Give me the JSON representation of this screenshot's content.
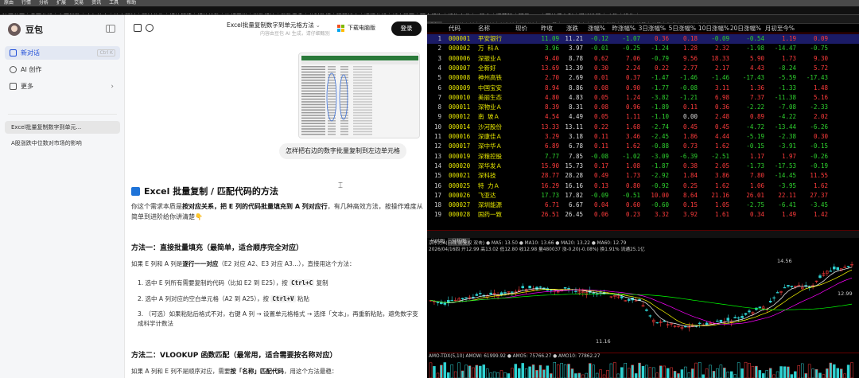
{
  "topbar": {
    "items": [
      "原由",
      "行情",
      "分析",
      "扩展",
      "交易",
      "资讯",
      "工具",
      "帮助"
    ]
  },
  "navbar": {
    "items": [
      "沪深首页",
      "盘面分析",
      "主要指数",
      "人气热点",
      "热点题材",
      "题材龙头",
      "板块解读",
      "板块轮动",
      "连板天梯",
      "指数板块",
      "涨跌看盘",
      "分时数据",
      "强弱排序",
      "运程分析",
      "新大股票",
      "研究报告",
      "机构内参",
      "A股会",
      "问董秘",
      "明星F10",
      "可转债套利",
      "漫谈选股",
      "功能",
      "操作"
    ]
  },
  "sidebar": {
    "app_name": "豆包",
    "nav": [
      {
        "label": "新对话",
        "kbd": "Ctrl K"
      },
      {
        "label": "AI 创作"
      },
      {
        "label": "更多"
      }
    ],
    "history": [
      "Excel批量复制数字到单元...",
      "A股涨跌中位数对市场的影响"
    ]
  },
  "chat": {
    "title": "Excel批量复制数字到单元格方法",
    "subtitle": "内容由豆包 AI 生成，请仔细甄别",
    "download_label": "下载电脑版",
    "login_label": "登录",
    "question": "怎样把右边的数字批量复制到左边单元格",
    "heading": "Excel 批量复制 / 匹配代码的方法",
    "intro_a": "你这个需求本质是",
    "intro_b": "按对应关系，把 E 列的代码批量填充到 A 列对应行",
    "intro_c": "，有几种高效方法，按操作难度从简单到进阶给你讲清楚👇",
    "m1_title": "方法一：直接批量填充（最简单，适合顺序完全对应）",
    "m1_desc_a": "如果 E 列和 A 列是",
    "m1_desc_b": "逐行一一对应",
    "m1_desc_c": "（E2 对应 A2、E3 对应 A3…），直接用这个方法：",
    "m1_steps": [
      {
        "pre": "1. 选中 E 列所有需要复制的代码（比如 E2 到 E25），按 ",
        "key": "Ctrl+C",
        "post": " 复制"
      },
      {
        "pre": "2. 选中 A 列对应的空白单元格（A2 到 A25），按 ",
        "key": "Ctrl+V",
        "post": " 粘贴"
      },
      {
        "pre": "3. （可选）如果粘贴后格式不对，右键 A 列 → 设置单元格格式 → 选择「文本」，再重新粘贴，避免数字变成科学计数法",
        "key": "",
        "post": ""
      }
    ],
    "m2_title": "方法二：VLOOKUP 函数匹配（最常用，适合需要按名称对应）",
    "m2_desc_a": "如果 A 列和 E 列不是顺序对应，需要",
    "m2_desc_b": "按「名称」匹配代码",
    "m2_desc_c": "，用这个方法最稳："
  },
  "stock": {
    "tabs": [
      "全部",
      "两融",
      "沪主板",
      "深主板",
      "创业板",
      "科创板",
      "北证A股",
      "B股",
      "基金",
      "债券",
      "指数",
      "板块",
      "港股",
      "美股",
      "期货",
      "自选",
      "其他",
      "模拟"
    ],
    "selected_tab": "全部",
    "headers": [
      "代码",
      "名称",
      "现价",
      "昨收",
      "涨跌",
      "涨幅%",
      "昨涨幅%",
      "3日涨幅%",
      "5日涨幅%",
      "10日涨幅%",
      "20日涨幅%",
      "月初至今%"
    ],
    "rows": [
      [
        "1",
        "000001",
        "平安银行",
        "11.09",
        "11.21",
        "-0.12",
        "-1.07",
        "0.36",
        "0.18",
        "-0.09",
        "-0.54",
        "1.19",
        "0.09"
      ],
      [
        "2",
        "000002",
        "万 科Ａ",
        "3.96",
        "3.97",
        "-0.01",
        "-0.25",
        "-1.24",
        "1.28",
        "2.32",
        "-1.98",
        "-14.47",
        "-0.75"
      ],
      [
        "3",
        "000006",
        "深振业Ａ",
        "9.40",
        "8.78",
        "0.62",
        "7.06",
        "-0.79",
        "9.56",
        "18.33",
        "5.90",
        "1.73",
        "9.30"
      ],
      [
        "4",
        "000007",
        "全新好",
        "13.69",
        "13.39",
        "0.30",
        "2.24",
        "0.22",
        "2.77",
        "2.17",
        "4.43",
        "-8.24",
        "5.72"
      ],
      [
        "5",
        "000008",
        "神州高铁",
        "2.70",
        "2.69",
        "0.01",
        "0.37",
        "-1.47",
        "-1.46",
        "-1.46",
        "-17.43",
        "-5.59",
        "-17.43"
      ],
      [
        "6",
        "000009",
        "中国宝安",
        "8.94",
        "8.86",
        "0.08",
        "0.90",
        "-1.77",
        "-0.08",
        "3.11",
        "1.36",
        "-1.33",
        "1.48"
      ],
      [
        "7",
        "000010",
        "美丽生态",
        "4.80",
        "4.83",
        "0.05",
        "1.24",
        "-3.82",
        "-1.21",
        "6.98",
        "7.37",
        "-11.38",
        "5.16"
      ],
      [
        "8",
        "000011",
        "深物业Ａ",
        "8.39",
        "8.31",
        "0.08",
        "0.96",
        "-1.89",
        "0.11",
        "0.36",
        "-2.22",
        "-7.08",
        "-2.33"
      ],
      [
        "9",
        "000012",
        "南 玻Ａ",
        "4.54",
        "4.49",
        "0.05",
        "1.11",
        "-1.10",
        "0.00",
        "2.48",
        "0.89",
        "-4.22",
        "2.02"
      ],
      [
        "10",
        "000014",
        "沙河股份",
        "13.33",
        "13.11",
        "0.22",
        "1.68",
        "-2.74",
        "0.45",
        "0.45",
        "-4.72",
        "-13.44",
        "-6.26"
      ],
      [
        "11",
        "000016",
        "深康佳Ａ",
        "3.29",
        "3.18",
        "0.11",
        "3.46",
        "-2.45",
        "1.86",
        "4.44",
        "-5.19",
        "-2.38",
        "0.30"
      ],
      [
        "12",
        "000017",
        "深中华Ａ",
        "6.89",
        "6.78",
        "0.11",
        "1.62",
        "-0.88",
        "0.73",
        "1.62",
        "-0.15",
        "-3.91",
        "-0.15"
      ],
      [
        "13",
        "000019",
        "深粮控股",
        "7.77",
        "7.85",
        "-0.08",
        "-1.02",
        "-3.09",
        "-6.39",
        "-2.51",
        "1.17",
        "1.97",
        "-0.26"
      ],
      [
        "14",
        "000020",
        "深华发Ａ",
        "15.90",
        "15.73",
        "0.17",
        "1.08",
        "-1.87",
        "0.38",
        "2.05",
        "-1.73",
        "-17.53",
        "-0.19"
      ],
      [
        "15",
        "000021",
        "深科技",
        "28.77",
        "28.28",
        "0.49",
        "1.73",
        "-2.92",
        "1.84",
        "3.86",
        "7.80",
        "-14.45",
        "11.55"
      ],
      [
        "16",
        "000025",
        "特 力Ａ",
        "16.29",
        "16.16",
        "0.13",
        "0.80",
        "-0.92",
        "0.25",
        "1.62",
        "1.06",
        "-3.95",
        "1.62"
      ],
      [
        "17",
        "000026",
        "飞亚达",
        "17.73",
        "17.82",
        "-0.09",
        "-0.51",
        "10.00",
        "8.64",
        "21.16",
        "26.01",
        "22.11",
        "27.37"
      ],
      [
        "18",
        "000027",
        "深圳能源",
        "6.71",
        "6.67",
        "0.04",
        "0.60",
        "-0.60",
        "0.15",
        "1.05",
        "-2.75",
        "-6.41",
        "-3.45"
      ],
      [
        "19",
        "000028",
        "国药一致",
        "26.51",
        "26.45",
        "0.06",
        "0.23",
        "3.32",
        "3.92",
        "1.61",
        "0.34",
        "1.49",
        "1.42"
      ]
    ],
    "chart_tabs": [
      "分时图",
      "分析图"
    ],
    "chart_info_1": "京东方A(日线 前复权 双击) ● MA5: 13.50 ● MA10: 13.66 ● MA20: 13.22 ● MA60: 12.79",
    "chart_info_2": "2026/04/16四 开12.99 高13.02 低12.80 收12.98 量480037 涨-0.20(-0.08%) 换1.91% 流通25.1亿",
    "price_labels": [
      "14.56",
      "12.99",
      "11.16"
    ],
    "vol_info": "AMO-TDX(5,10)  AMOW: 61999.92 ● AMO5: 75766.27 ● AMO10: 77862.27"
  }
}
